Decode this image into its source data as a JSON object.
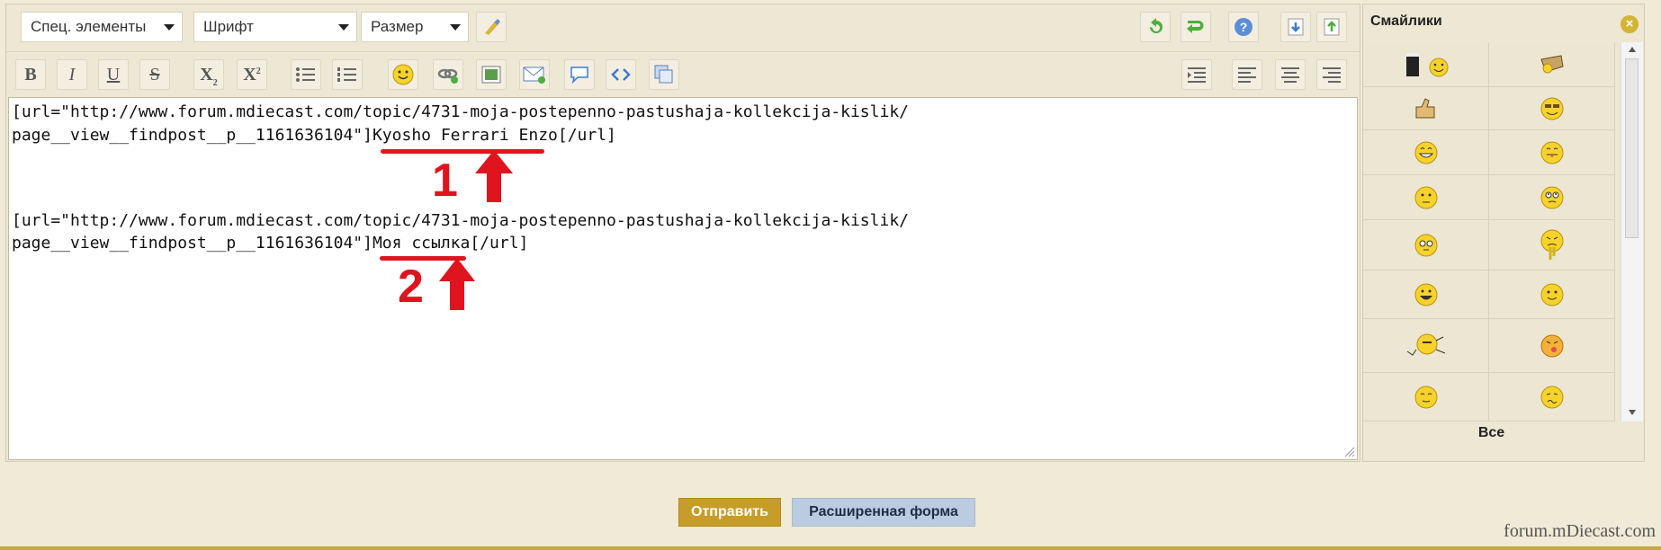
{
  "toolbar": {
    "dropdowns": [
      "Спец. элементы",
      "Шрифт",
      "Размер"
    ],
    "icons_row1": [
      "brush-icon",
      "undo-icon",
      "redo-icon",
      "help-icon",
      "download-icon",
      "upload-icon"
    ],
    "icons_row2": [
      "bold-icon",
      "italic-icon",
      "underline-icon",
      "strikethrough-icon",
      "subscript-icon",
      "superscript-icon",
      "bulleted-list-icon",
      "numbered-list-icon",
      "emoticon-icon",
      "link-icon",
      "image-icon",
      "email-icon",
      "quote-icon",
      "code-icon",
      "media-icon",
      "indent-icon",
      "align-left-icon",
      "align-center-icon",
      "align-right-icon"
    ],
    "bold": "B",
    "italic": "I",
    "underline": "U",
    "strike": "S",
    "sub_base": "X",
    "sub": "2",
    "sup_base": "X",
    "sup": "2"
  },
  "editor": {
    "line1": "[url=\"http://www.forum.mdiecast.com/topic/4731-moja-postepenno-pastushaja-kollekcija-kislik/",
    "line2_prefix": "page__view__findpost__p__1161636104\"]",
    "line2_link": "Kyosho Ferrari Enzo",
    "line2_suffix": "[/url]",
    "line3": "[url=\"http://www.forum.mdiecast.com/topic/4731-moja-postepenno-pastushaja-kollekcija-kislik/",
    "line4_prefix": "page__view__findpost__p__1161636104\"]",
    "line4_link": "Моя ссылка",
    "line4_suffix": "[/url]",
    "annotation1": "1",
    "annotation2": "2"
  },
  "smileys": {
    "title": "Смайлики",
    "close": "×",
    "all_label": "Все",
    "items": [
      [
        "beer-smiley-icon",
        "map-smiley-icon"
      ],
      [
        "thumbs-up-smiley-icon",
        "cool-smiley-icon"
      ],
      [
        "grin-smiley-icon",
        "tongue-smiley-icon"
      ],
      [
        "neutral-smiley-icon",
        "rolling-eyes-smiley-icon"
      ],
      [
        "wink-smiley-icon",
        "sick-smiley-icon"
      ],
      [
        "laugh-smiley-icon",
        "smile-smiley-icon"
      ],
      [
        "running-smiley-icon",
        "angry-smiley-icon"
      ],
      [
        "happy-smiley-icon",
        "confused-smiley-icon"
      ]
    ]
  },
  "buttons": {
    "send": "Отправить",
    "advanced": "Расширенная форма"
  },
  "watermark": "forum.mDiecast.com",
  "colors": {
    "accent_red": "#e0141e",
    "send_button": "#c79d2a",
    "advanced_button": "#bccce0",
    "smiley_yellow": "#f7d22a"
  }
}
